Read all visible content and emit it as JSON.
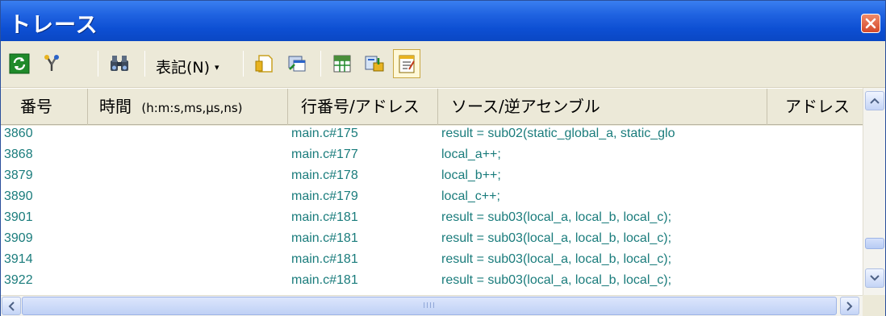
{
  "window": {
    "title": "トレース"
  },
  "toolbar": {
    "notation_label": "表記(N)",
    "notation_arrow": "▾"
  },
  "columns": [
    {
      "label": "番号"
    },
    {
      "label": "時間",
      "sub": "(h:m:s,ms,μs,ns)"
    },
    {
      "label": "行番号/アドレス"
    },
    {
      "label": "ソース/逆アセンブル"
    },
    {
      "label": "アドレス"
    }
  ],
  "rows": [
    {
      "number": "3860",
      "time": "",
      "line": "main.c#175",
      "source": "result = sub02(static_global_a, static_glo"
    },
    {
      "number": "3868",
      "time": "",
      "line": "main.c#177",
      "source": "local_a++;"
    },
    {
      "number": "3879",
      "time": "",
      "line": "main.c#178",
      "source": "local_b++;"
    },
    {
      "number": "3890",
      "time": "",
      "line": "main.c#179",
      "source": "local_c++;"
    },
    {
      "number": "3901",
      "time": "",
      "line": "main.c#181",
      "source": "result = sub03(local_a, local_b, local_c);"
    },
    {
      "number": "3909",
      "time": "",
      "line": "main.c#181",
      "source": "result = sub03(local_a, local_b, local_c);"
    },
    {
      "number": "3914",
      "time": "",
      "line": "main.c#181",
      "source": "result = sub03(local_a, local_b, local_c);"
    },
    {
      "number": "3922",
      "time": "",
      "line": "main.c#181",
      "source": "result = sub03(local_a, local_b, local_c);"
    }
  ],
  "scrollbar": {
    "hthumb_grip": "IIII"
  },
  "colors": {
    "titlebar": "#0d4fd3",
    "row_text": "#1a7c7c",
    "panel": "#ece9d8"
  }
}
